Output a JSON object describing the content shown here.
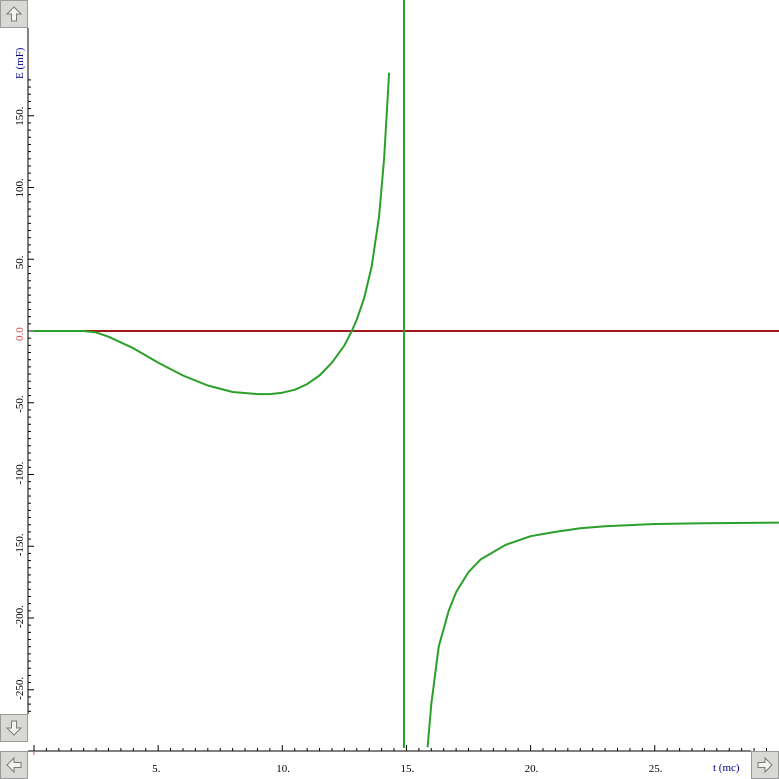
{
  "chart_data": {
    "type": "line",
    "xlabel": "t (mc)",
    "ylabel": "E (mF)",
    "xlim": [
      0,
      30
    ],
    "ylim": [
      -290,
      180
    ],
    "x_ticks": [
      {
        "value": 5,
        "label": "5."
      },
      {
        "value": 10,
        "label": "10."
      },
      {
        "value": 15,
        "label": "15."
      },
      {
        "value": 20,
        "label": "20."
      },
      {
        "value": 25,
        "label": "25."
      }
    ],
    "y_ticks": [
      {
        "value": 150,
        "label": "150."
      },
      {
        "value": 100,
        "label": "100."
      },
      {
        "value": 50,
        "label": "50."
      },
      {
        "value": 0,
        "label": "0.0"
      },
      {
        "value": -50,
        "label": "-50."
      },
      {
        "value": -100,
        "label": "-100."
      },
      {
        "value": -150,
        "label": "-150."
      },
      {
        "value": -200,
        "label": "-200."
      },
      {
        "value": -250,
        "label": "-250."
      }
    ],
    "series": [
      {
        "color": "#2aa02a",
        "segments": [
          [
            [
              0,
              0
            ],
            [
              1,
              0
            ],
            [
              2,
              0
            ],
            [
              2.5,
              -1
            ],
            [
              3,
              -4
            ],
            [
              4,
              -12
            ],
            [
              5,
              -22
            ],
            [
              6,
              -31
            ],
            [
              7,
              -38
            ],
            [
              8,
              -42.5
            ],
            [
              9,
              -44
            ],
            [
              9.5,
              -44
            ],
            [
              10,
              -43
            ],
            [
              10.5,
              -41
            ],
            [
              11,
              -37
            ],
            [
              11.5,
              -31
            ],
            [
              12,
              -22
            ],
            [
              12.5,
              -10
            ],
            [
              12.8,
              0
            ],
            [
              13,
              8
            ],
            [
              13.3,
              23
            ],
            [
              13.6,
              45
            ],
            [
              13.9,
              80
            ],
            [
              14.1,
              120
            ],
            [
              14.2,
              150
            ],
            [
              14.3,
              180
            ]
          ],
          [
            [
              15.85,
              -290
            ],
            [
              16,
              -260
            ],
            [
              16.3,
              -220
            ],
            [
              16.7,
              -195
            ],
            [
              17,
              -182
            ],
            [
              17.5,
              -168
            ],
            [
              18,
              -159
            ],
            [
              19,
              -149
            ],
            [
              20,
              -143
            ],
            [
              21,
              -140
            ],
            [
              22,
              -137.5
            ],
            [
              23,
              -136
            ],
            [
              25,
              -134.5
            ],
            [
              27,
              -134
            ],
            [
              30,
              -133.5
            ]
          ]
        ],
        "asymptote_x": 14.9
      },
      {
        "color": "#a01818",
        "values": [
          [
            0,
            0
          ],
          [
            30,
            0
          ]
        ]
      }
    ],
    "grid": false
  },
  "colors": {
    "curve": "#2aa02a",
    "reference_line": "#a01818",
    "axis_title": "#00008b",
    "zero_label": "#e05050"
  },
  "icons": {
    "up": "arrow-up-icon",
    "down": "arrow-down-icon",
    "left": "arrow-left-icon",
    "right": "arrow-right-icon"
  }
}
